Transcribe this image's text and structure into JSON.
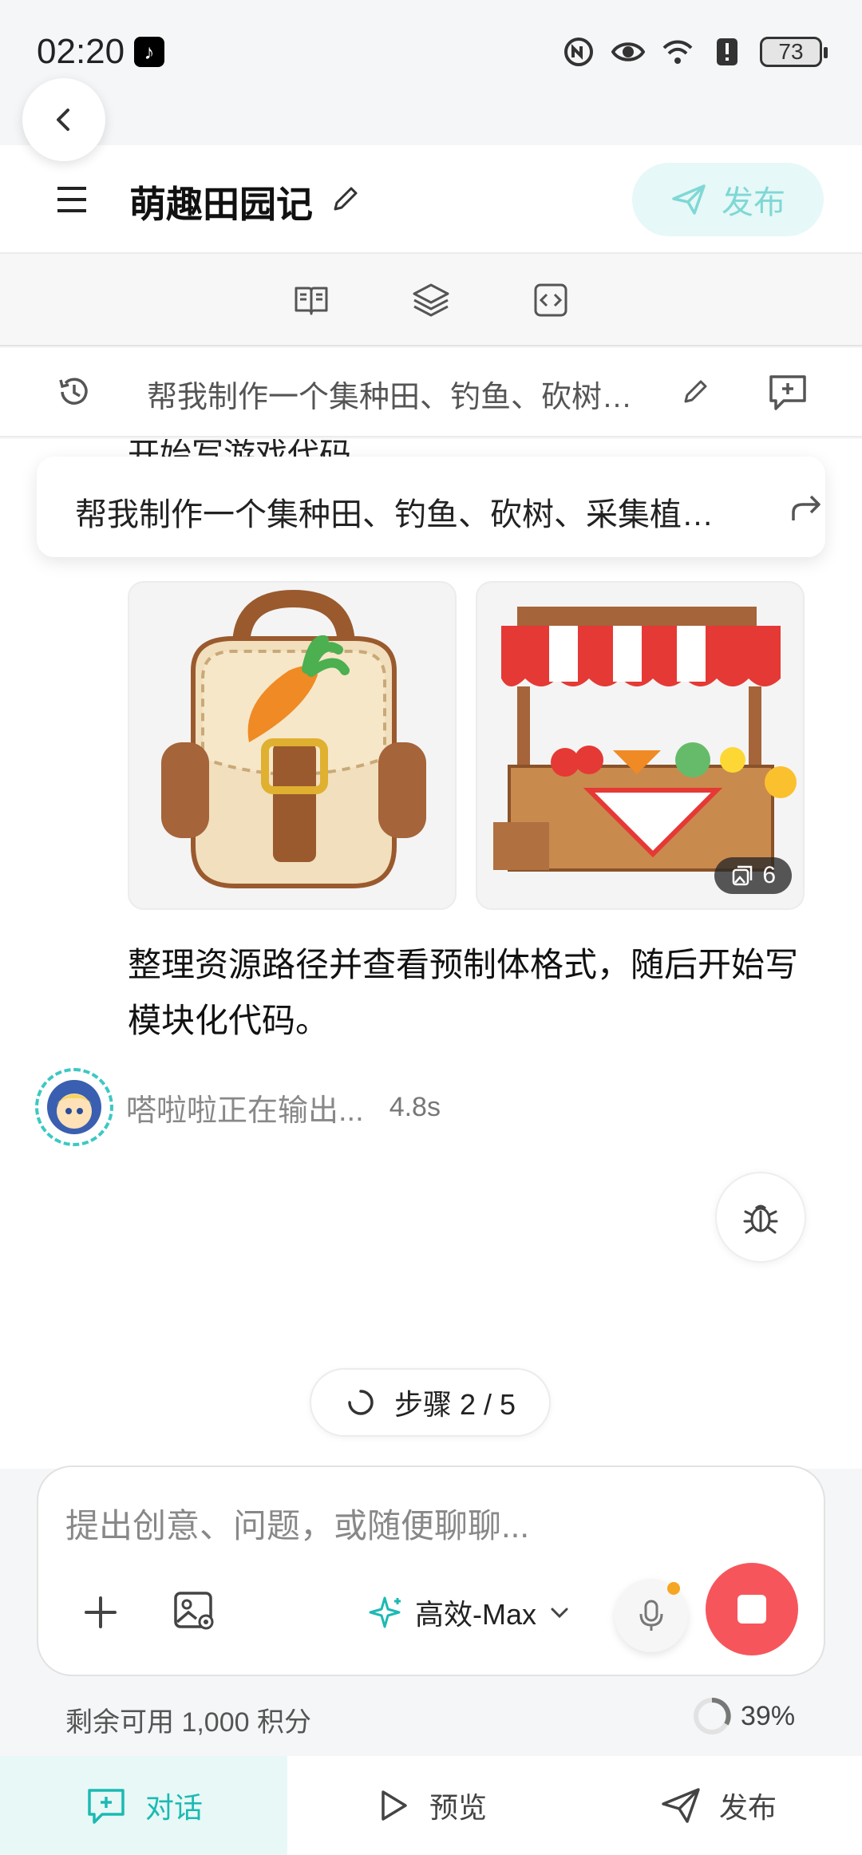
{
  "status_bar": {
    "time": "02:20",
    "battery": "73"
  },
  "header": {
    "title": "萌趣田园记",
    "publish_label": "发布"
  },
  "prompt_bar": {
    "text": "帮我制作一个集种田、钓鱼、砍树…"
  },
  "chat": {
    "cut_text": "开始写游戏代码",
    "floating_prompt": "帮我制作一个集种田、钓鱼、砍树、采集植…",
    "image_count": "6",
    "message": "整理资源路径并查看预制体格式，随后开始写模块化代码。",
    "agent_status": "嗒啦啦正在输出...",
    "agent_duration": "4.8s",
    "step": "步骤 2 / 5"
  },
  "composer": {
    "placeholder": "提出创意、问题，或随便聊聊...",
    "model": "高效-Max"
  },
  "footer": {
    "credits": "剩余可用 1,000 积分",
    "progress": "39%"
  },
  "tabs": [
    {
      "label": "对话",
      "icon": "chat-plus-icon",
      "active": true
    },
    {
      "label": "预览",
      "icon": "play-icon",
      "active": false
    },
    {
      "label": "发布",
      "icon": "send-icon",
      "active": false
    }
  ],
  "colors": {
    "accent": "#1bbab3",
    "stop": "#f7555c"
  }
}
